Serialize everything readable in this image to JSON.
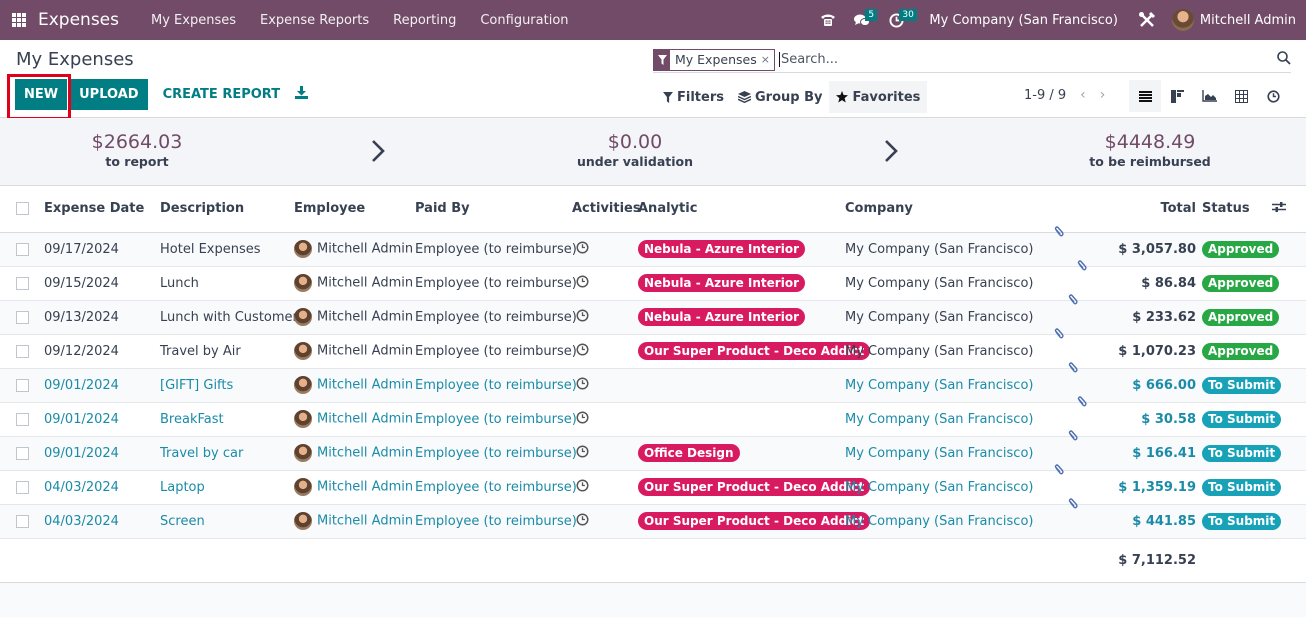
{
  "navbar": {
    "app_name": "Expenses",
    "menu": [
      "My Expenses",
      "Expense Reports",
      "Reporting",
      "Configuration"
    ],
    "messages_count": "5",
    "activities_count": "30",
    "company": "My Company (San Francisco)",
    "user": "Mitchell Admin"
  },
  "control_panel": {
    "title": "My Expenses",
    "buttons": {
      "new": "NEW",
      "upload": "UPLOAD",
      "create_report": "CREATE REPORT"
    },
    "search": {
      "facet_label": "My Expenses",
      "placeholder": "Search..."
    },
    "filters_label": "Filters",
    "group_by_label": "Group By",
    "favorites_label": "Favorites",
    "pager": "1-9 / 9"
  },
  "summary": [
    {
      "amount": "$2664.03",
      "label": "to report"
    },
    {
      "amount": "$0.00",
      "label": "under validation"
    },
    {
      "amount": "$4448.49",
      "label": "to be reimbursed"
    }
  ],
  "table": {
    "columns": [
      "Expense Date",
      "Description",
      "Employee",
      "Paid By",
      "Activities",
      "Analytic",
      "Company",
      "Total",
      "Status"
    ],
    "rows": [
      {
        "date": "09/17/2024",
        "description": "Hotel Expenses",
        "employee": "Mitchell Admin",
        "paid_by": "Employee (to reimburse)",
        "analytic": "Nebula - Azure Interior",
        "company": "My Company (San Francisco)",
        "total": "$ 3,057.80",
        "status": "Approved"
      },
      {
        "date": "09/15/2024",
        "description": "Lunch",
        "employee": "Mitchell Admin",
        "paid_by": "Employee (to reimburse)",
        "analytic": "Nebula - Azure Interior",
        "company": "My Company (San Francisco)",
        "total": "$ 86.84",
        "status": "Approved"
      },
      {
        "date": "09/13/2024",
        "description": "Lunch with Customer",
        "employee": "Mitchell Admin",
        "paid_by": "Employee (to reimburse)",
        "analytic": "Nebula - Azure Interior",
        "company": "My Company (San Francisco)",
        "total": "$ 233.62",
        "status": "Approved"
      },
      {
        "date": "09/12/2024",
        "description": "Travel by Air",
        "employee": "Mitchell Admin",
        "paid_by": "Employee (to reimburse)",
        "analytic": "Our Super Product - Deco Addict",
        "company": "My Company (San Francisco)",
        "total": "$ 1,070.23",
        "status": "Approved"
      },
      {
        "date": "09/01/2024",
        "description": "[GIFT] Gifts",
        "employee": "Mitchell Admin",
        "paid_by": "Employee (to reimburse)",
        "analytic": "",
        "company": "My Company (San Francisco)",
        "total": "$ 666.00",
        "status": "To Submit"
      },
      {
        "date": "09/01/2024",
        "description": "BreakFast",
        "employee": "Mitchell Admin",
        "paid_by": "Employee (to reimburse)",
        "analytic": "",
        "company": "My Company (San Francisco)",
        "total": "$ 30.58",
        "status": "To Submit"
      },
      {
        "date": "09/01/2024",
        "description": "Travel by car",
        "employee": "Mitchell Admin",
        "paid_by": "Employee (to reimburse)",
        "analytic": "Office Design",
        "company": "My Company (San Francisco)",
        "total": "$ 166.41",
        "status": "To Submit"
      },
      {
        "date": "04/03/2024",
        "description": "Laptop",
        "employee": "Mitchell Admin",
        "paid_by": "Employee (to reimburse)",
        "analytic": "Our Super Product - Deco Addict",
        "company": "My Company (San Francisco)",
        "total": "$ 1,359.19",
        "status": "To Submit"
      },
      {
        "date": "04/03/2024",
        "description": "Screen",
        "employee": "Mitchell Admin",
        "paid_by": "Employee (to reimburse)",
        "analytic": "Our Super Product - Deco Addict",
        "company": "My Company (San Francisco)",
        "total": "$ 441.85",
        "status": "To Submit"
      }
    ],
    "grand_total": "$ 7,112.52"
  },
  "colors": {
    "brand": "#714b67",
    "primary": "#017e84",
    "tag": "#d81b60",
    "approved": "#28a745",
    "to_submit": "#17a2b8"
  }
}
